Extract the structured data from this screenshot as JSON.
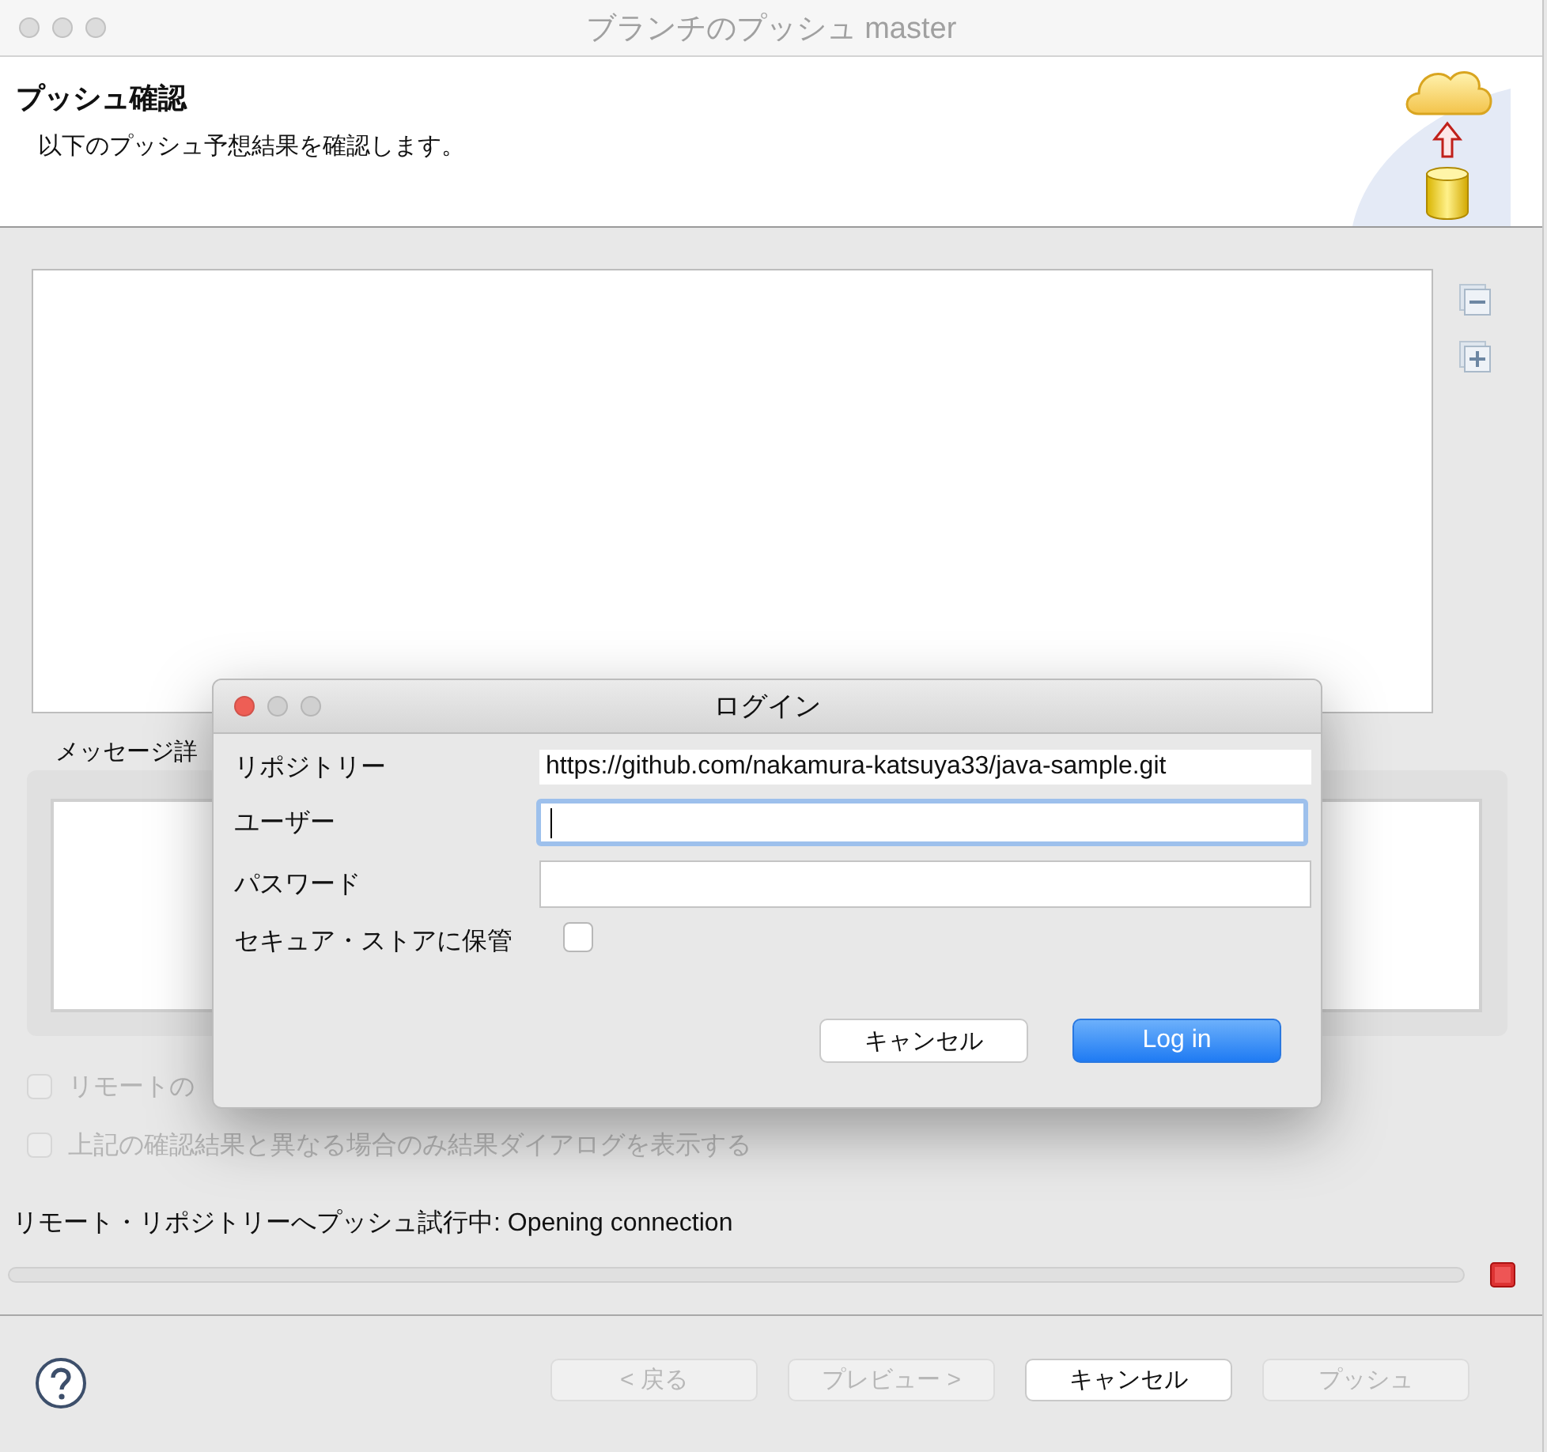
{
  "window": {
    "title": "ブランチのプッシュ master"
  },
  "header": {
    "title": "プッシュ確認",
    "description": "以下のプッシュ予想結果を確認します。"
  },
  "message_details": {
    "label": "メッセージ詳"
  },
  "options": [
    {
      "label": "リモートの",
      "checked": false,
      "disabled": true
    },
    {
      "label": "上記の確認結果と異なる場合のみ結果ダイアログを表示する",
      "checked": false,
      "disabled": true
    }
  ],
  "status": {
    "text": "リモート・リポジトリーへプッシュ試行中: Opening connection",
    "level": 0
  },
  "buttons": [
    {
      "label": "< 戻る",
      "disabled": true
    },
    {
      "label": "プレビュー >",
      "disabled": true
    },
    {
      "label": "キャンセル",
      "disabled": false
    },
    {
      "label": "プッシュ",
      "disabled": true
    }
  ],
  "login_dialog": {
    "title": "ログイン",
    "fields": [
      {
        "kind": "text",
        "label": "リポジトリー",
        "value": "https://github.com/nakamura-katsuya33/java-sample.git"
      },
      {
        "kind": "input",
        "label": "ユーザー",
        "focused": true
      },
      {
        "kind": "input",
        "label": "パスワード",
        "focused": false
      },
      {
        "kind": "checkbox",
        "label": "セキュア・ストアに保管",
        "checked": false
      }
    ],
    "buttons": [
      {
        "label": "キャンセル",
        "default": false
      },
      {
        "label": "Log in",
        "default": true
      }
    ]
  }
}
